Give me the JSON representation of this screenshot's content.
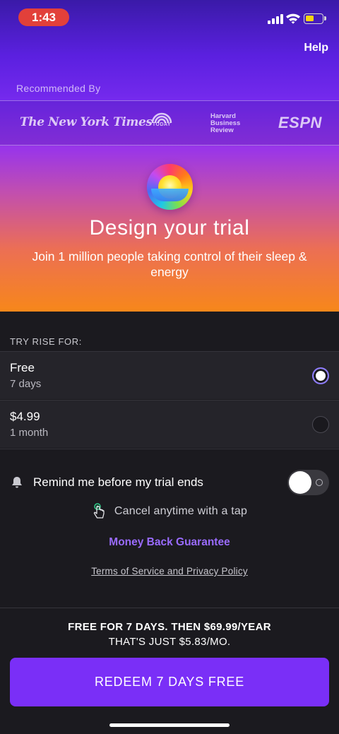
{
  "status_bar": {
    "time": "1:43"
  },
  "header": {
    "help_label": "Help"
  },
  "recommended": {
    "label": "Recommended By",
    "logos": [
      {
        "name": "The New York Times"
      },
      {
        "name": "TODAY"
      },
      {
        "name": "Harvard Business Review",
        "lines": [
          "Harvard",
          "Business",
          "Review"
        ]
      },
      {
        "name": "ESPN"
      }
    ]
  },
  "hero": {
    "title": "Design your trial",
    "subtitle": "Join 1 million people taking control of their sleep & energy"
  },
  "trial": {
    "label": "TRY RISE FOR:",
    "plans": [
      {
        "name": "Free",
        "period": "7 days",
        "selected": true
      },
      {
        "name": "$4.99",
        "period": "1 month",
        "selected": false
      }
    ]
  },
  "reminder": {
    "label": "Remind me before my trial ends",
    "enabled": false
  },
  "cancel": {
    "label": "Cancel anytime with a tap"
  },
  "guarantee": {
    "label": "Money Back Guarantee"
  },
  "terms": {
    "label": "Terms of Service and Privacy Policy"
  },
  "pricing": {
    "main": "FREE FOR 7 DAYS. THEN $69.99/YEAR",
    "sub": "THAT'S JUST $5.83/MO."
  },
  "cta": {
    "label": "REDEEM 7 DAYS FREE"
  },
  "colors": {
    "accent": "#7a2ff7",
    "guarantee": "#9a6bff",
    "time_pill": "#e2403a",
    "battery": "#f5d60e"
  }
}
